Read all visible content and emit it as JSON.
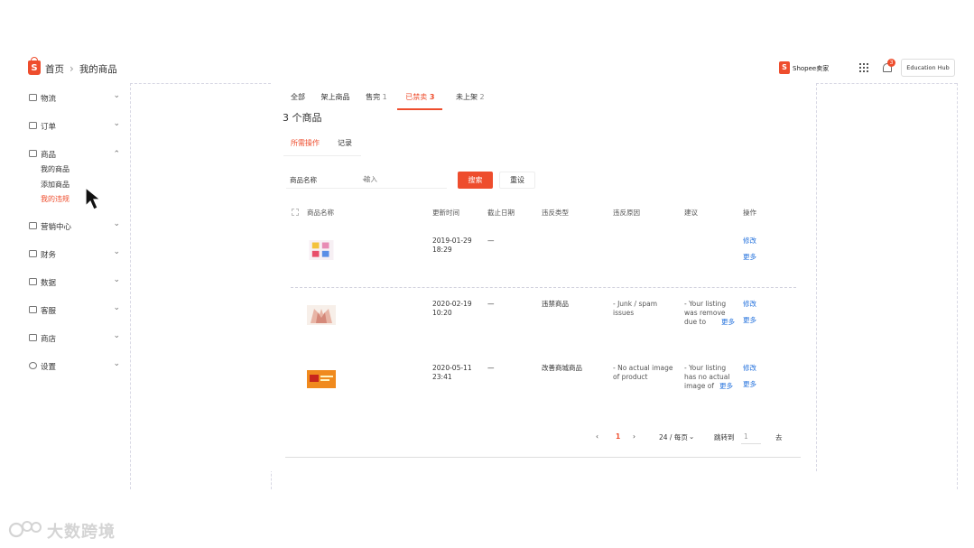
{
  "header": {
    "breadcrumb": [
      "首页",
      "我的商品"
    ],
    "seller_logo_text": "Shopee卖家",
    "notification_count": "3",
    "edu_hub_label": "Education Hub"
  },
  "sidebar": {
    "items": [
      {
        "label": "物流",
        "icon": "truck-icon"
      },
      {
        "label": "订单",
        "icon": "order-icon"
      },
      {
        "label": "商品",
        "icon": "product-icon",
        "expanded": true,
        "children": [
          "我的商品",
          "添加商品",
          "我的违规"
        ],
        "active_child": "我的违规"
      },
      {
        "label": "营销中心",
        "icon": "tag-icon"
      },
      {
        "label": "财务",
        "icon": "wallet-icon"
      },
      {
        "label": "数据",
        "icon": "chart-icon"
      },
      {
        "label": "客服",
        "icon": "chat-icon"
      },
      {
        "label": "商店",
        "icon": "shop-icon"
      },
      {
        "label": "设置",
        "icon": "gear-icon"
      }
    ]
  },
  "main": {
    "tabs": [
      {
        "label": "全部",
        "count": ""
      },
      {
        "label": "架上商品",
        "count": ""
      },
      {
        "label": "售完",
        "count": "1"
      },
      {
        "label": "已禁卖",
        "count": "3",
        "active": true
      },
      {
        "label": "未上架",
        "count": "2"
      }
    ],
    "count_title": "3 个商品",
    "subtabs": {
      "active": "所需操作",
      "other": "记录"
    },
    "filter": {
      "select_value": "商品名称",
      "input_placeholder": "输入",
      "search_label": "搜索",
      "reset_label": "重设"
    },
    "columns": [
      "商品名称",
      "更新时间",
      "截止日期",
      "违反类型",
      "违反原因",
      "建议",
      "操作"
    ],
    "rows": [
      {
        "updated": "2019-01-29",
        "time": "18:29",
        "deadline": "—",
        "type": "",
        "reason": "",
        "suggestion": "",
        "actions": [
          "修改",
          "更多"
        ]
      },
      {
        "updated": "2020-02-19",
        "time": "10:20",
        "deadline": "—",
        "type": "违禁商品",
        "reason": "- Junk / spam issues",
        "suggestion": "- Your listing was remove due to excessive and unneces...",
        "more": "更多",
        "actions": [
          "修改",
          "更多"
        ]
      },
      {
        "updated": "2020-05-11",
        "time": "23:41",
        "deadline": "—",
        "type": "改善商城商品",
        "reason": "- No actual image of product",
        "suggestion": "- Your listing has no actual image of product stated. Pl...",
        "more": "更多",
        "actions": [
          "修改",
          "更多"
        ]
      }
    ],
    "pagination": {
      "prev": "‹",
      "current": "1",
      "next": "›",
      "page_size": "24 / 每页",
      "jump_label": "跳转到",
      "jump_value": "1",
      "go_label": "去"
    }
  },
  "watermark": {
    "text": "大数跨境"
  },
  "colors": {
    "accent": "#ee4d2d",
    "link": "#2673dd"
  }
}
